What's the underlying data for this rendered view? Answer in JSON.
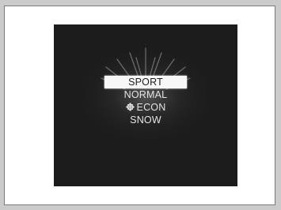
{
  "drive_mode_menu": {
    "items": [
      {
        "label": "SPORT",
        "selected": true
      },
      {
        "label": "NORMAL",
        "selected": false
      },
      {
        "label": "ECON",
        "selected": false,
        "icon": "econ-leaf-icon"
      },
      {
        "label": "SNOW",
        "selected": false
      }
    ]
  },
  "colors": {
    "screen_background": "#1c1c1c",
    "highlight": "#f7f7f7",
    "text": "#e4e4e4"
  }
}
